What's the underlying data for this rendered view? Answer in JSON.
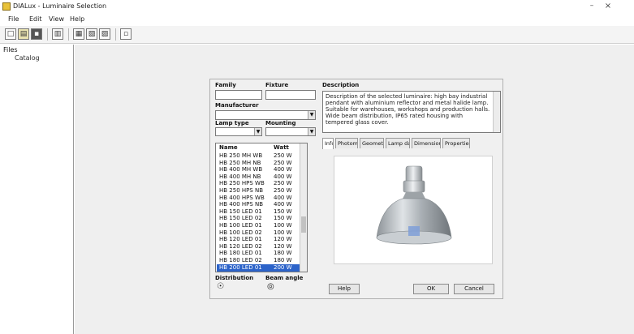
{
  "window": {
    "title": "DIALux - Luminaire Selection",
    "minimize_glyph": "–",
    "close_glyph": "×"
  },
  "menu": [
    "File",
    "Edit",
    "View",
    "Help"
  ],
  "toolbar": {
    "icons": [
      "new-icon",
      "open-icon",
      "save-icon",
      "print-icon",
      "copy-icon",
      "paste-icon",
      "table-icon",
      "settings-icon"
    ]
  },
  "tree": {
    "root": "Files",
    "child": "Catalog"
  },
  "dialog": {
    "labels": {
      "family": "Family",
      "fixture": "Fixture",
      "manufacturer": "Manufacturer",
      "lamp_type": "Lamp type",
      "mounting": "Mounting",
      "description": "Description",
      "list_col_name": "Name",
      "list_col_watt": "Watt",
      "distribution": "Distribution",
      "beam_angle": "Beam angle"
    },
    "values": {
      "manufacturer": "",
      "family": "",
      "fixture": "",
      "lamp_type": "",
      "mounting": ""
    },
    "description": "Description of the selected luminaire: high bay industrial pendant with aluminium reflector and metal halide lamp. Suitable for warehouses, workshops and production halls. Wide beam distribution, IP65 rated housing with tempered glass cover.",
    "tabs": [
      "Info",
      "Photometry",
      "Geometry",
      "Lamp data",
      "Dimensions",
      "Properties"
    ],
    "active_tab": 0,
    "list": [
      {
        "name": "HB 250 MH WB",
        "watt": "250 W"
      },
      {
        "name": "HB 250 MH NB",
        "watt": "250 W"
      },
      {
        "name": "HB 400 MH WB",
        "watt": "400 W"
      },
      {
        "name": "HB 400 MH NB",
        "watt": "400 W"
      },
      {
        "name": "HB 250 HPS WB",
        "watt": "250 W"
      },
      {
        "name": "HB 250 HPS NB",
        "watt": "250 W"
      },
      {
        "name": "HB 400 HPS WB",
        "watt": "400 W"
      },
      {
        "name": "HB 400 HPS NB",
        "watt": "400 W"
      },
      {
        "name": "HB 150 LED 01",
        "watt": "150 W"
      },
      {
        "name": "HB 150 LED 02",
        "watt": "150 W"
      },
      {
        "name": "HB 100 LED 01",
        "watt": "100 W"
      },
      {
        "name": "HB 100 LED 02",
        "watt": "100 W"
      },
      {
        "name": "HB 120 LED 01",
        "watt": "120 W"
      },
      {
        "name": "HB 120 LED 02",
        "watt": "120 W"
      },
      {
        "name": "HB 180 LED 01",
        "watt": "180 W"
      },
      {
        "name": "HB 180 LED 02",
        "watt": "180 W"
      },
      {
        "name": "HB 200 LED 01",
        "watt": "200 W"
      }
    ],
    "selected_index": 16,
    "buttons": {
      "help": "Help",
      "ok": "OK",
      "cancel": "Cancel"
    }
  }
}
